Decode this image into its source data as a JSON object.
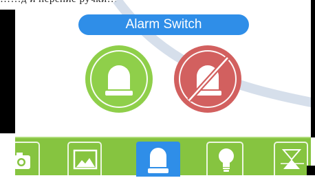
{
  "top_strip": {
    "text": "……д и нерение ручки…"
  },
  "header": {
    "title": "Alarm Switch"
  },
  "alarm": {
    "on_state": {
      "icon": "siren-icon",
      "color": "#8fcf4a"
    },
    "off_state": {
      "icon": "siren-off-icon",
      "color": "#d2605f"
    }
  },
  "tabbar": {
    "background": "#86c440",
    "active_color": "#2f8ee8",
    "tabs": [
      {
        "icon": "camera-icon",
        "active": false
      },
      {
        "icon": "gallery-icon",
        "active": false
      },
      {
        "icon": "alarm-icon",
        "active": true
      },
      {
        "icon": "lightbulb-icon",
        "active": false
      },
      {
        "icon": "hourglass-icon",
        "active": false
      }
    ]
  }
}
